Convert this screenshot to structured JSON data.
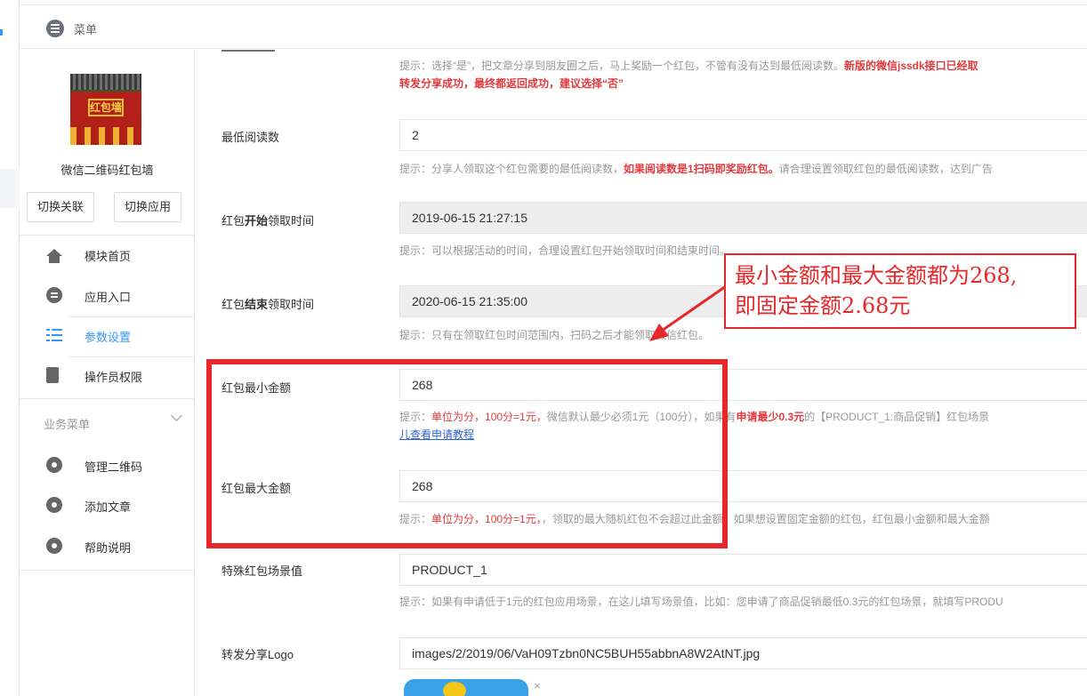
{
  "header": {
    "menu_title": "菜单"
  },
  "sidebar": {
    "app_name": "微信二维码红包墙",
    "logo_text": "红包墙",
    "buttons": [
      "切换关联",
      "切换应用"
    ],
    "nav": [
      {
        "label": "模块首页",
        "icon": "home-icon"
      },
      {
        "label": "应用入口",
        "icon": "chat-icon"
      },
      {
        "label": "参数设置",
        "icon": "list-icon",
        "active": true
      },
      {
        "label": "操作员权限",
        "icon": "doc-icon"
      }
    ],
    "group_label": "业务菜单",
    "group_items": [
      {
        "label": "管理二维码",
        "icon": "gear-icon"
      },
      {
        "label": "添加文章",
        "icon": "gear-icon"
      },
      {
        "label": "帮助说明",
        "icon": "gear-icon"
      }
    ]
  },
  "form": {
    "top_hint": {
      "line1_a": "提示：选择“是”，把文章分享到朋友圈之后，马上奖励一个红包，不管有没有达到最低阅读数。",
      "line1_red": "新版的微信jssdk接口已经取",
      "line2_red": "转发分享成功，最终都返回成功，建议选择“否”"
    },
    "min_read": {
      "label": "最低阅读数",
      "value": "2",
      "hint_a": "提示：分享人领取这个红包需要的最低阅读数，",
      "hint_red": "如果阅读数是1扫码即奖励红包。",
      "hint_b": "请合理设置领取红包的最低阅读数，达到广告"
    },
    "start_time": {
      "label_a": "红包",
      "label_b": "开始",
      "label_c": "领取时间",
      "value": "2019-06-15 21:27:15",
      "hint": "提示：可以根据活动的时间，合理设置红包开始领取时间和结束时间。"
    },
    "end_time": {
      "label_a": "红包",
      "label_b": "结束",
      "label_c": "领取时间",
      "value": "2020-06-15 21:35:00",
      "hint": "提示：只有在领取红包时间范围内，扫码之后才能领取微信红包。"
    },
    "min_amount": {
      "label": "红包最小金额",
      "value": "268",
      "hint_a": "提示：",
      "hint_red": "单位为分，100分=1元，",
      "hint_b": "微信默认最少必须1元（100分），如果有",
      "hint_red2": "申请最少0.3元",
      "hint_c": "的【PRODUCT_1:商品促销】红包场景",
      "hint_link": "儿查看申请教程"
    },
    "max_amount": {
      "label": "红包最大金额",
      "value": "268",
      "hint_a": "提示：",
      "hint_red": "单位为分，100分=1元，",
      "hint_b": "，领取的最大随机红包不会超过此金额，如果想设置固定金额的红包，红包最小金额和最大金额"
    },
    "scene": {
      "label": "特殊红包场景值",
      "value": "PRODUCT_1",
      "hint": "提示：如果有申请低于1元的红包应用场景，在这儿填写场景值，比如：您申请了商品促销最低0.3元的红包场景，就填写PRODU"
    },
    "share_logo": {
      "label": "转发分享Logo",
      "value": "images/2/2019/06/VaH09Tzbn0NC5BUH55abbnA8W2AtNT.jpg",
      "close": "×"
    }
  },
  "annotation": {
    "line1": "最小金额和最大金额都为268,",
    "line2": "即固定金额2.68元",
    "color": "#e8272b"
  }
}
